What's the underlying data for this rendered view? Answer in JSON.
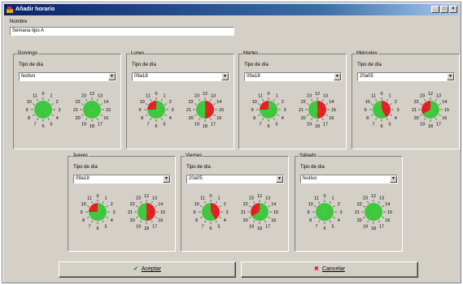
{
  "window": {
    "title": "Añadir horario",
    "buttons": [
      "_",
      "□",
      "×"
    ]
  },
  "form": {
    "nombre_label": "Nombre",
    "nombre_value": "Semana tipo A",
    "tipo_label": "Tipo de día"
  },
  "days": [
    {
      "name": "Domingo",
      "tipo": "festivo",
      "am": [],
      "pm": []
    },
    {
      "name": "Lunes",
      "tipo": "09a18",
      "am": [
        9,
        10,
        11
      ],
      "pm": [
        12,
        13,
        14,
        15,
        16,
        17
      ]
    },
    {
      "name": "Martes",
      "tipo": "09a18",
      "am": [
        9,
        10,
        11
      ],
      "pm": [
        12,
        13,
        14,
        15,
        16,
        17
      ]
    },
    {
      "name": "Miércoles",
      "tipo": "20a05",
      "am": [
        0,
        1,
        2,
        3,
        4
      ],
      "pm": [
        20,
        21,
        22,
        23
      ]
    },
    {
      "name": "Jueves",
      "tipo": "09a18",
      "am": [
        9,
        10,
        11
      ],
      "pm": [
        12,
        13,
        14,
        15,
        16,
        17
      ]
    },
    {
      "name": "Viernes",
      "tipo": "20a05",
      "am": [
        0,
        1,
        2,
        3,
        4
      ],
      "pm": [
        20,
        21,
        22,
        23
      ]
    },
    {
      "name": "Sábado",
      "tipo": "festivo",
      "am": [],
      "pm": []
    }
  ],
  "clock_labels": {
    "am": [
      "0",
      "1",
      "2",
      "3",
      "4",
      "5",
      "6",
      "7",
      "8",
      "9",
      "10",
      "11"
    ],
    "pm": [
      "12",
      "13",
      "14",
      "15",
      "16",
      "17",
      "18",
      "19",
      "20",
      "21",
      "22",
      "23"
    ]
  },
  "actions": {
    "accept_label": "Aceptar",
    "cancel_label": "Cancelar"
  },
  "colors": {
    "inactive_hour": "#3cc83c",
    "active_hour": "#e02020",
    "accept_icon": "#1a9a1a",
    "cancel_icon": "#d02020"
  },
  "icons": {
    "accept": "check-icon",
    "cancel": "x-icon",
    "title": "app-icon"
  }
}
